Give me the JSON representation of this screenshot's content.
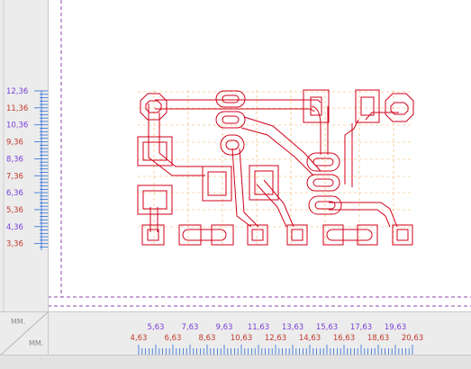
{
  "rulers": {
    "vertical": {
      "labels": [
        "12,36",
        "11,36",
        "10,36",
        "9,36",
        "8,36",
        "7,36",
        "6,36",
        "5,36",
        "4,36",
        "3,36"
      ],
      "label_colors": [
        "#7a3fd6",
        "#c0392b",
        "#7a3fd6",
        "#c0392b",
        "#7a3fd6",
        "#c0392b",
        "#7a3fd6",
        "#c0392b",
        "#7a3fd6",
        "#c0392b"
      ]
    },
    "horizontal": {
      "top_labels": [
        "5,63",
        "7,63",
        "9,63",
        "11,63",
        "13,63",
        "15,63",
        "17,63",
        "19,63"
      ],
      "bottom_labels": [
        "4,63",
        "6,63",
        "8,63",
        "10,63",
        "12,63",
        "14,63",
        "16,63",
        "18,63",
        "20,63"
      ],
      "top_color": "#7a3fd6",
      "bottom_color": "#c0392b"
    },
    "corner_units": {
      "top": "MM.",
      "bottom": "MM."
    }
  },
  "colors": {
    "trace": "#d0021b",
    "ruler_ticks": "#2b6cd8",
    "guide": "#8e44ad",
    "grid": "#f0b060"
  }
}
